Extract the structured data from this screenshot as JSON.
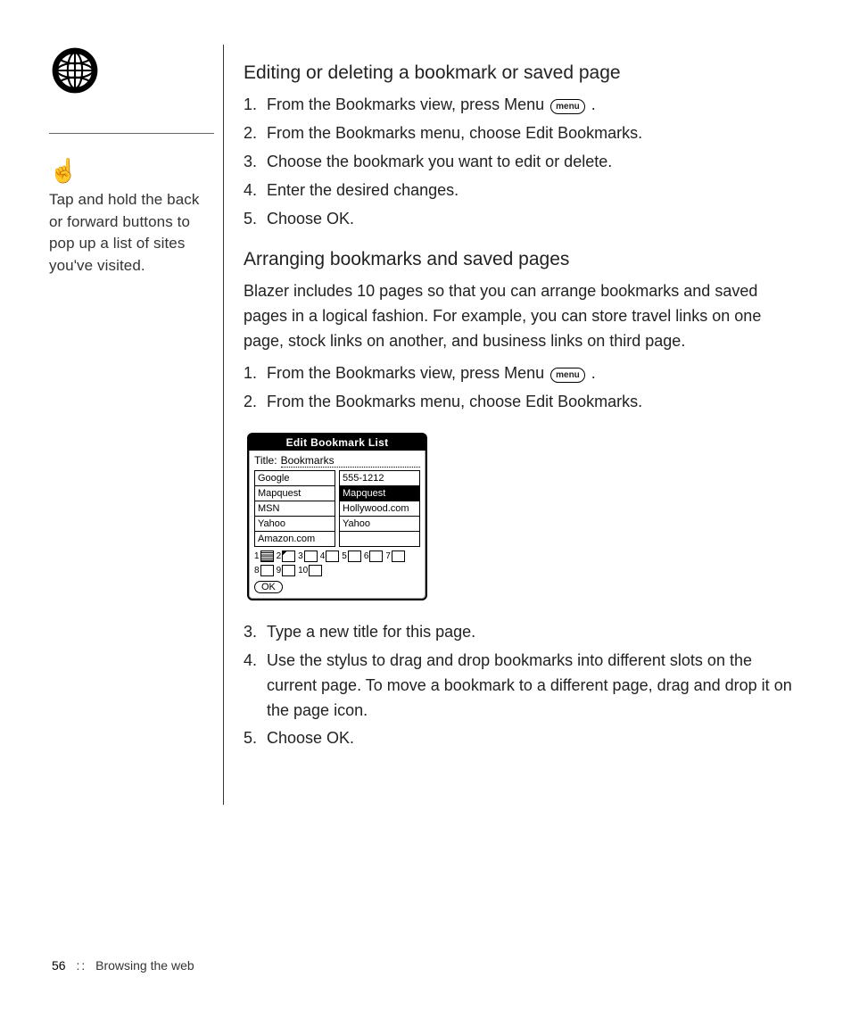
{
  "sidebar": {
    "tip_text": "Tap and hold the back or forward buttons to pop up a list of sites you've visited."
  },
  "section1": {
    "heading": "Editing or deleting a bookmark or saved page",
    "steps": [
      {
        "n": "1.",
        "pre": "From the Bookmarks view, press Menu ",
        "menu": "menu",
        "post": " ."
      },
      {
        "n": "2.",
        "pre": "From the Bookmarks menu, choose Edit Bookmarks."
      },
      {
        "n": "3.",
        "pre": "Choose the bookmark you want to edit or delete."
      },
      {
        "n": "4.",
        "pre": "Enter the desired changes."
      },
      {
        "n": "5.",
        "pre": "Choose OK."
      }
    ]
  },
  "section2": {
    "heading": "Arranging bookmarks and saved pages",
    "intro": "Blazer includes 10 pages so that you can arrange bookmarks and saved pages in a logical fashion. For example, you can store travel links on one page, stock links on another, and business links on third page.",
    "steps_a": [
      {
        "n": "1.",
        "pre": "From the Bookmarks view, press Menu ",
        "menu": "menu",
        "post": " ."
      },
      {
        "n": "2.",
        "pre": "From the Bookmarks menu, choose Edit Bookmarks."
      }
    ],
    "steps_b": [
      {
        "n": "3.",
        "pre": "Type a new title for this page."
      },
      {
        "n": "4.",
        "pre": "Use the stylus to drag and drop bookmarks into different slots on the current page. To move a bookmark to a different page, drag and drop it on the page icon."
      },
      {
        "n": "5.",
        "pre": "Choose OK."
      }
    ]
  },
  "palm": {
    "titlebar": "Edit Bookmark List",
    "title_label": "Title:",
    "title_value": "Bookmarks",
    "left_col": [
      "Google",
      "Mapquest",
      "MSN",
      "Yahoo",
      "Amazon.com"
    ],
    "right_col": [
      "555-1212",
      "Mapquest",
      "Hollywood.com",
      "Yahoo",
      ""
    ],
    "right_selected_index": 1,
    "pages": [
      "1",
      "2",
      "3",
      "4",
      "5",
      "6",
      "7",
      "8",
      "9",
      "10"
    ],
    "ok": "OK"
  },
  "footer": {
    "page_number": "56",
    "separator": "::",
    "chapter": "Browsing the web"
  }
}
